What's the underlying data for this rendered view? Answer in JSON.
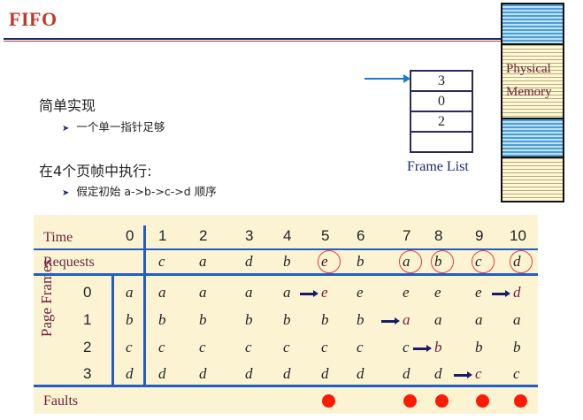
{
  "slide": {
    "title": "FIFO",
    "section1": {
      "heading": "简单实现",
      "bullet": "一个单一指针足够"
    },
    "section2": {
      "heading": "在4个页帧中执行:",
      "bullet": "假定初始 a->b->c->d 顺序"
    }
  },
  "frame_list": {
    "cells": [
      "3",
      "0",
      "2",
      ""
    ],
    "label": "Frame List"
  },
  "memory": {
    "label_line1": "Physical",
    "label_line2": "Memory"
  },
  "table": {
    "time_label": "Time",
    "requests_label": "Requests",
    "page_frames_label": "Page Frames",
    "faults_label": "Faults",
    "times": [
      "0",
      "1",
      "2",
      "3",
      "4",
      "5",
      "6",
      "7",
      "8",
      "9",
      "10"
    ],
    "requests": [
      "",
      "c",
      "a",
      "d",
      "b",
      "e",
      "b",
      "a",
      "b",
      "c",
      "d"
    ],
    "frame_ids": [
      "0",
      "1",
      "2",
      "3"
    ],
    "frames": [
      [
        "a",
        "a",
        "a",
        "a",
        "a",
        "e",
        "e",
        "e",
        "e",
        "e",
        "d"
      ],
      [
        "b",
        "b",
        "b",
        "b",
        "b",
        "b",
        "b",
        "a",
        "a",
        "a",
        "a"
      ],
      [
        "c",
        "c",
        "c",
        "c",
        "c",
        "c",
        "c",
        "c",
        "b",
        "b",
        "b"
      ],
      [
        "d",
        "d",
        "d",
        "d",
        "d",
        "d",
        "d",
        "d",
        "d",
        "c",
        "c"
      ]
    ],
    "faults": [
      false,
      false,
      false,
      false,
      false,
      true,
      false,
      true,
      true,
      true,
      true
    ]
  },
  "colors": {
    "title": "#c0392b",
    "table_bg": "#fcf3d2",
    "blue_lines": "#1f5fc7",
    "fault_dot": "#ff1a00",
    "circle": "#e04040"
  }
}
